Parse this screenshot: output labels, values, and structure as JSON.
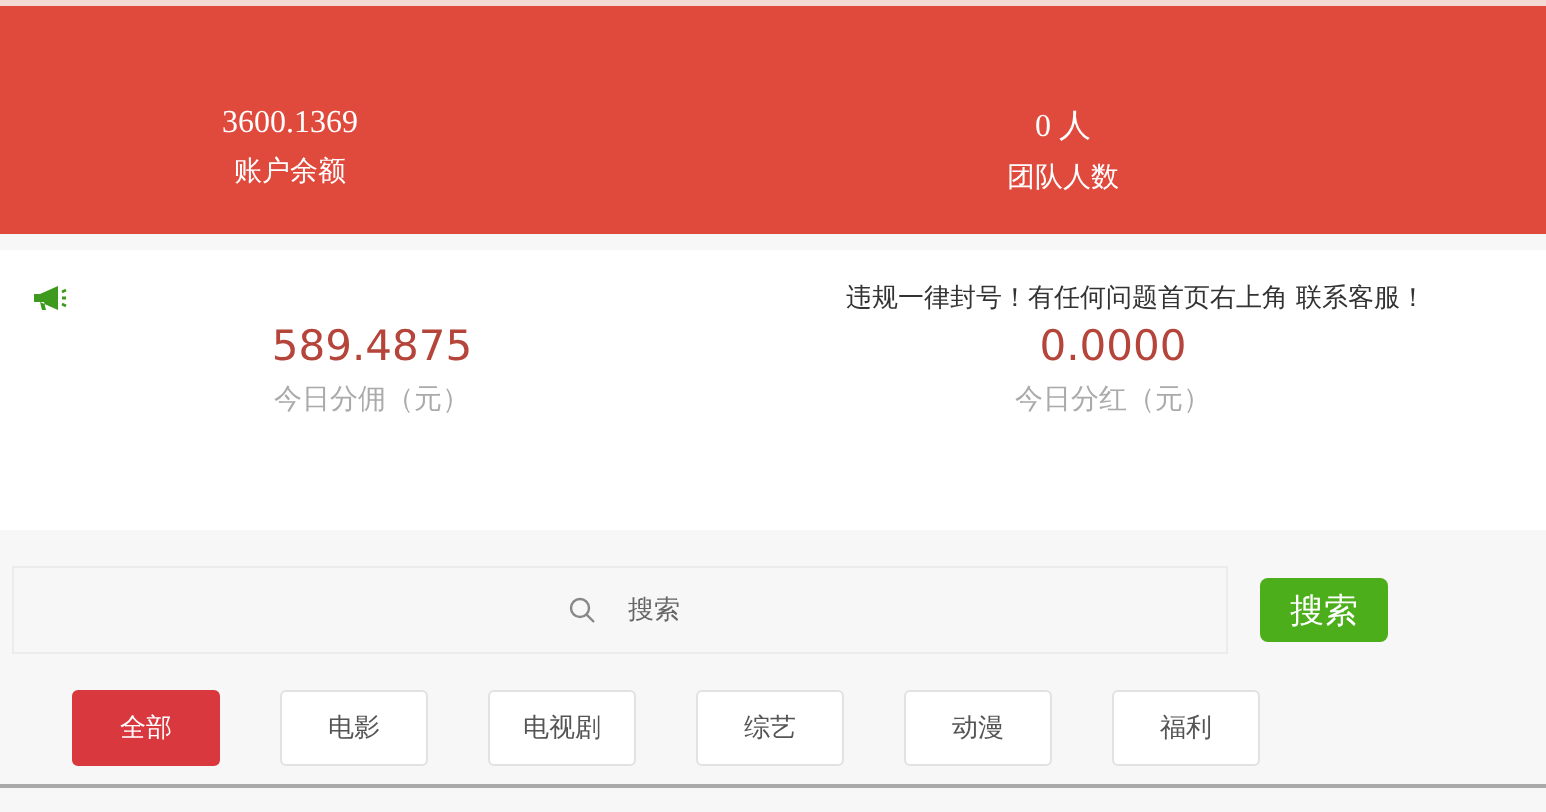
{
  "header": {
    "stats": [
      {
        "value": "3600.1369",
        "label": "账户余额"
      },
      {
        "value": "0 人",
        "label": "团队人数"
      }
    ]
  },
  "notice": {
    "text": "违规一律封号！有任何问题首页右上角 联系客服！"
  },
  "today": [
    {
      "value": "589.4875",
      "label": "今日分佣（元）"
    },
    {
      "value": "0.0000",
      "label": "今日分红（元）"
    }
  ],
  "search": {
    "placeholder": "搜索",
    "button": "搜索"
  },
  "categories": [
    {
      "label": "全部",
      "selected": true
    },
    {
      "label": "电影",
      "selected": false
    },
    {
      "label": "电视剧",
      "selected": false
    },
    {
      "label": "综艺",
      "selected": false
    },
    {
      "label": "动漫",
      "selected": false
    },
    {
      "label": "福利",
      "selected": false
    }
  ]
}
